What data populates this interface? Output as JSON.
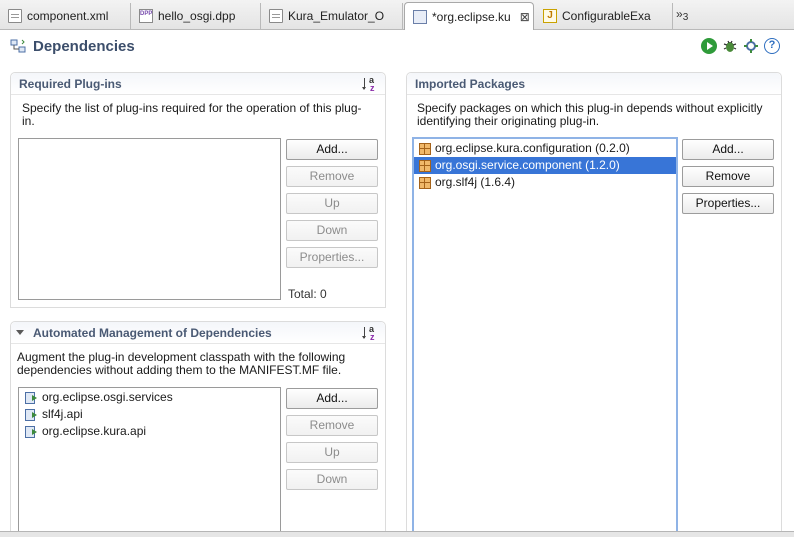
{
  "editor_tabs": [
    {
      "label": "component.xml",
      "icon": "xml-file-icon",
      "active": false
    },
    {
      "label": "hello_osgi.dpp",
      "icon": "dpp-file-icon",
      "active": false
    },
    {
      "label": "Kura_Emulator_O",
      "icon": "launch-file-icon",
      "active": false
    },
    {
      "label": "*org.eclipse.ku",
      "icon": "plugin-manifest-icon",
      "active": true
    },
    {
      "label": "ConfigurableExa",
      "icon": "java-file-icon",
      "active": false
    }
  ],
  "tab_overflow": {
    "symbol": "»",
    "count": "3"
  },
  "header": {
    "title": "Dependencies"
  },
  "required_plugins": {
    "title": "Required Plug-ins",
    "description": "Specify the list of plug-ins required for the operation of this plug-in.",
    "items": [],
    "buttons": {
      "add": "Add...",
      "remove": "Remove",
      "up": "Up",
      "down": "Down",
      "properties": "Properties..."
    },
    "total": "Total: 0"
  },
  "automated_management": {
    "title": "Automated Management of Dependencies",
    "description": "Augment the plug-in development classpath with the following dependencies without adding them to the MANIFEST.MF file.",
    "items": [
      "org.eclipse.osgi.services",
      "slf4j.api",
      "org.eclipse.kura.api"
    ],
    "buttons": {
      "add": "Add...",
      "remove": "Remove",
      "up": "Up",
      "down": "Down"
    }
  },
  "imported_packages": {
    "title": "Imported Packages",
    "description": "Specify packages on which this plug-in depends without explicitly identifying their originating plug-in.",
    "items": [
      {
        "label": "org.eclipse.kura.configuration (0.2.0)",
        "selected": false
      },
      {
        "label": "org.osgi.service.component (1.2.0)",
        "selected": true
      },
      {
        "label": "org.slf4j (1.6.4)",
        "selected": false
      }
    ],
    "buttons": {
      "add": "Add...",
      "remove": "Remove",
      "properties": "Properties..."
    }
  },
  "colors": {
    "section_title": "#4a5a74",
    "form_title": "#3c4e6b",
    "selection": "#3875d7"
  }
}
